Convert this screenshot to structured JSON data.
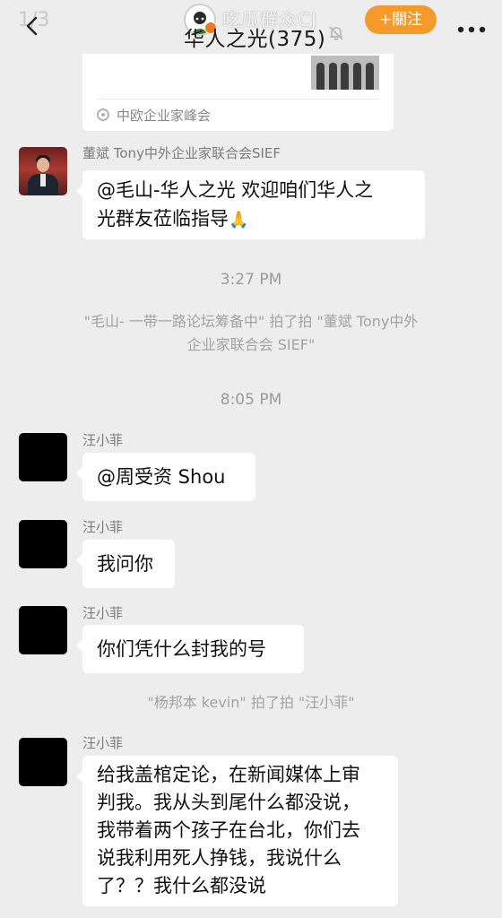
{
  "header": {
    "page_indicator": "1/3",
    "watermark_name": "吃瓜群众CJ",
    "chat_title": "华人之光(375)",
    "follow_label": "+關注"
  },
  "card": {
    "source": "中欧企业家峰会"
  },
  "messages": [
    {
      "sender": "董斌 Tony中外企业家联合会SIEF",
      "lines": [
        "@毛山-华人之光 欢迎咱们华人之",
        "光群友莅临指导"
      ],
      "emoji": "🙏"
    },
    {
      "sender": "汪小菲",
      "lines": [
        "@周受资 Shou"
      ]
    },
    {
      "sender": "汪小菲",
      "lines": [
        "我问你"
      ]
    },
    {
      "sender": "汪小菲",
      "lines": [
        "你们凭什么封我的号"
      ]
    },
    {
      "sender": "汪小菲",
      "lines": [
        "给我盖棺定论，在新闻媒体上审",
        "判我。我从头到尾什么都没说，",
        "我带着两个孩子在台北，你们去",
        "说我利用死人挣钱，我说什么",
        "了？？我什么都没说"
      ]
    }
  ],
  "times": [
    "3:27 PM",
    "8:05 PM"
  ],
  "system_notes": {
    "pat_1": [
      "\"毛山- 一带一路论坛筹备中\" 拍了拍 \"董斌 Tony中外",
      "企业家联合会 SIEF\""
    ],
    "pat_2": "\"杨邦本 kevin\" 拍了拍 \"汪小菲\""
  },
  "icons": {
    "back": "chevron-left-icon",
    "mute": "bell-off-icon",
    "more": "more-dots-icon"
  },
  "colors": {
    "background": "#ededed",
    "bubble": "#ffffff",
    "follow_button": "#f39a2b"
  }
}
